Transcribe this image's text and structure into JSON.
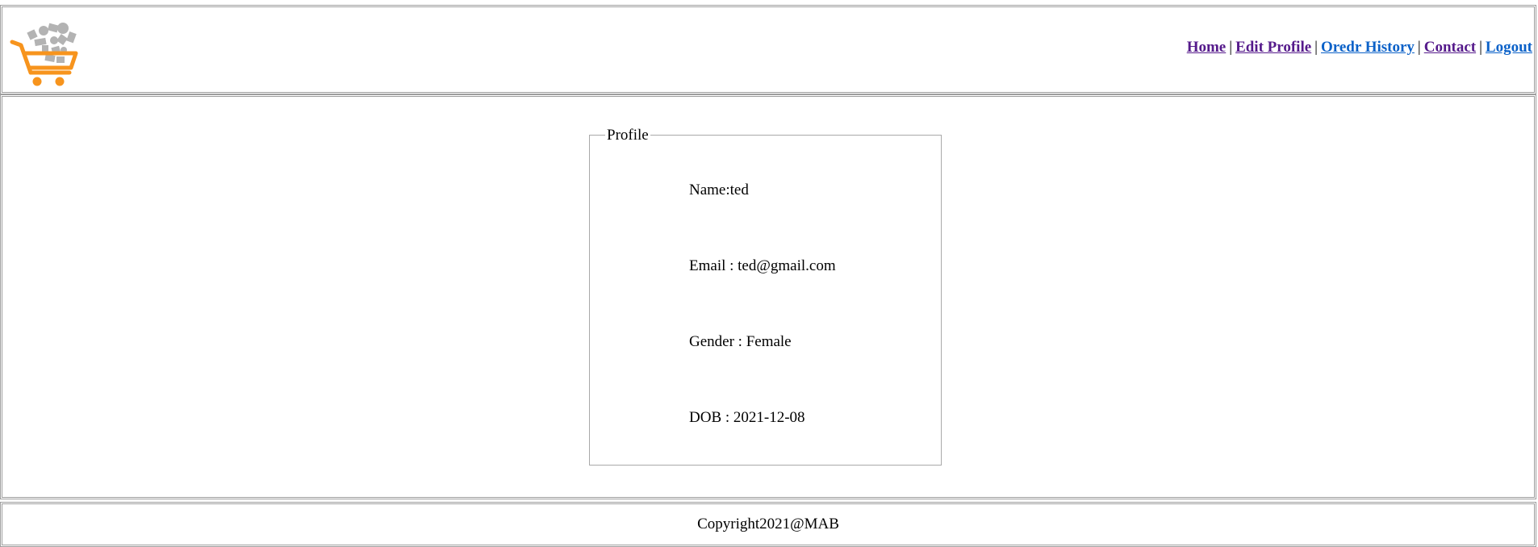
{
  "header": {
    "logo_icon": "shopping-cart-logo-icon",
    "nav": [
      {
        "label": "Home",
        "state": "visited"
      },
      {
        "label": "Edit Profile",
        "state": "visited"
      },
      {
        "label": "Oredr History",
        "state": "unvisited"
      },
      {
        "label": "Contact",
        "state": "visited"
      },
      {
        "label": "Logout",
        "state": "unvisited"
      }
    ],
    "separator": "|"
  },
  "profile": {
    "legend": "Profile",
    "name_line": "Name:ted",
    "email_line": "Email : ted@gmail.com",
    "gender_line": "Gender : Female",
    "dob_line": "DOB : 2021-12-08"
  },
  "footer": {
    "copyright": "Copyright2021@MAB"
  },
  "colors": {
    "visited_link": "#551a8b",
    "link": "#0b61c8",
    "cart_orange": "#f7941d",
    "cart_items_gray": "#b3b3b3",
    "border": "#9e9e9e"
  }
}
